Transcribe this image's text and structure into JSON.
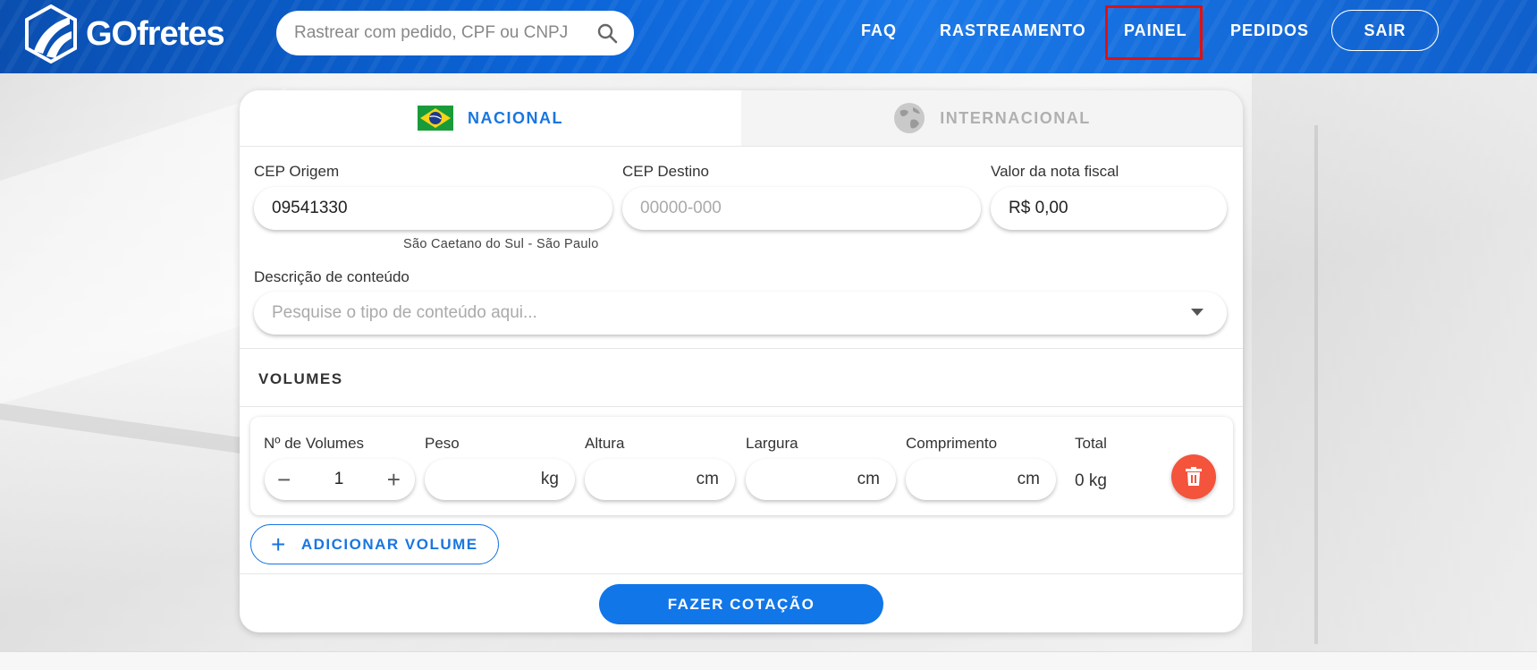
{
  "header": {
    "logo_text": "GOfretes",
    "search_placeholder": "Rastrear com pedido, CPF ou CNPJ",
    "nav": {
      "faq": "FAQ",
      "rastreamento": "RASTREAMENTO",
      "painel": "PAINEL",
      "pedidos": "PEDIDOS",
      "sair": "SAIR"
    },
    "highlight_color": "#e01010"
  },
  "tabs": {
    "nacional": "NACIONAL",
    "internacional": "INTERNACIONAL"
  },
  "form": {
    "cep_origem_label": "CEP Origem",
    "cep_origem_value": "09541330",
    "cep_origem_helper": "São Caetano do Sul - São Paulo",
    "cep_destino_label": "CEP Destino",
    "cep_destino_placeholder": "00000-000",
    "valor_label": "Valor da nota fiscal",
    "valor_value": "R$ 0,00",
    "descricao_label": "Descrição de conteúdo",
    "descricao_placeholder": "Pesquise o tipo de conteúdo aqui..."
  },
  "volumes": {
    "title": "VOLUMES",
    "labels": {
      "qtd": "Nº de Volumes",
      "peso": "Peso",
      "altura": "Altura",
      "largura": "Largura",
      "comprimento": "Comprimento",
      "total": "Total"
    },
    "qtd_value": "1",
    "units": {
      "peso": "kg",
      "altura": "cm",
      "largura": "cm",
      "comprimento": "cm"
    },
    "total_value": "0 kg",
    "add_label": "ADICIONAR VOLUME"
  },
  "submit_label": "FAZER COTAÇÃO",
  "colors": {
    "primary": "#1176e8",
    "danger": "#f4533c"
  }
}
